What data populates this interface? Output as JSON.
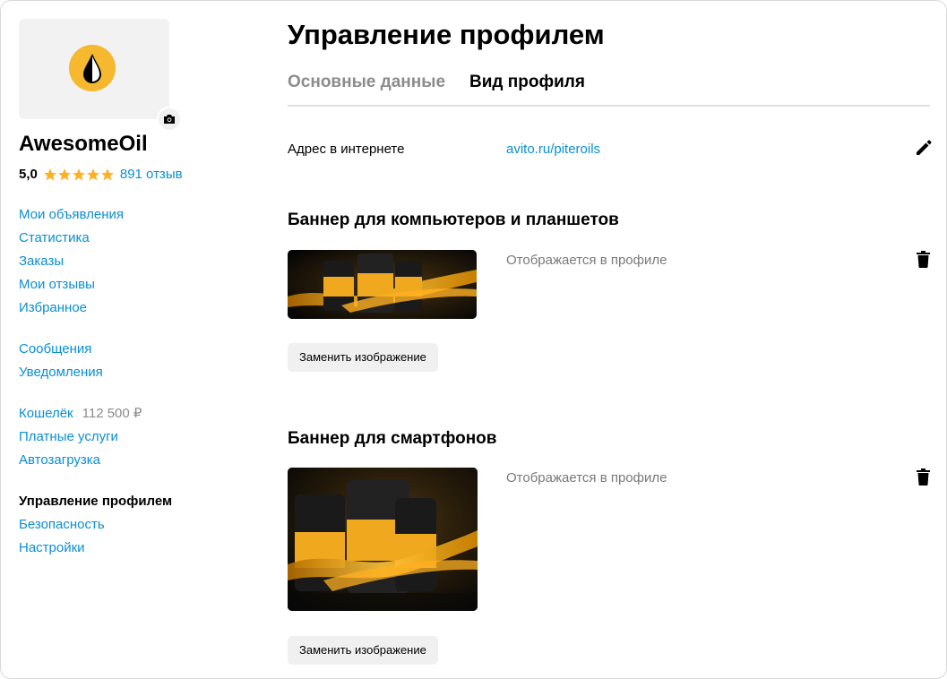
{
  "sidebar": {
    "shop_name": "AwesomeOil",
    "rating": "5,0",
    "stars": 5,
    "reviews": "891 отзыв",
    "nav_group1": [
      "Мои объявления",
      "Статистика",
      "Заказы",
      "Мои отзывы",
      "Избранное"
    ],
    "nav_group2": [
      "Сообщения",
      "Уведомления"
    ],
    "wallet_label": "Кошелёк",
    "wallet_amount": "112 500 ₽",
    "nav_group3": [
      "Платные услуги",
      "Автозагрузка"
    ],
    "active_item": "Управление профилем",
    "nav_group4": [
      "Безопасность",
      "Настройки"
    ]
  },
  "main": {
    "title": "Управление профилем",
    "tabs": [
      {
        "label": "Основные данные",
        "active": false
      },
      {
        "label": "Вид профиля",
        "active": true
      }
    ],
    "address_label": "Адрес в интернете",
    "address_value": "avito.ru/piteroils",
    "banner_desktop": {
      "title": "Баннер для компьютеров и планшетов",
      "status": "Отображается в профиле",
      "replace_label": "Заменить изображение"
    },
    "banner_mobile": {
      "title": "Баннер для смартфонов",
      "status": "Отображается в профиле",
      "replace_label": "Заменить изображение"
    }
  },
  "colors": {
    "link": "#0a8fd3",
    "star": "#ffb021",
    "logo": "#f5b82e",
    "muted": "#8c8c8c"
  },
  "icons": [
    "camera-icon",
    "star-icon",
    "edit-pencil-icon",
    "trash-icon",
    "oil-drop-logo"
  ]
}
